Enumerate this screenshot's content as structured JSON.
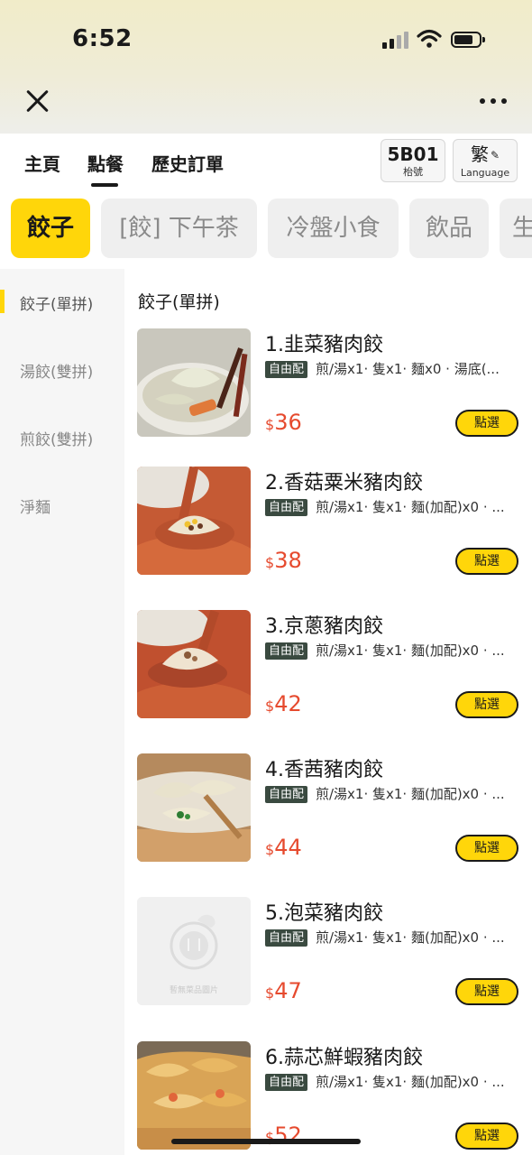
{
  "status_bar": {
    "time": "6:52"
  },
  "nav": {
    "tabs": [
      {
        "label": "主頁",
        "active": false
      },
      {
        "label": "點餐",
        "active": true
      },
      {
        "label": "歷史訂單",
        "active": false
      }
    ],
    "table_number": "5B01",
    "table_label": "枱號",
    "language_value": "繁",
    "language_label": "Language"
  },
  "categories": [
    {
      "label": "餃子",
      "active": true
    },
    {
      "label": "[餃] 下午茶",
      "active": false
    },
    {
      "label": "冷盤小食",
      "active": false
    },
    {
      "label": "飲品",
      "active": false
    },
    {
      "label": "生",
      "active": false
    }
  ],
  "sidebar": [
    {
      "label": "餃子(單拼)",
      "active": true
    },
    {
      "label": "湯餃(雙拼)",
      "active": false
    },
    {
      "label": "煎餃(雙拼)",
      "active": false
    },
    {
      "label": "淨麵",
      "active": false
    }
  ],
  "section_title": "餃子(單拼)",
  "items": [
    {
      "name": "1.韭菜豬肉餃",
      "tag": "自由配",
      "desc": "煎/湯x1· 隻x1· 麵x0 · 湯底(...",
      "currency": "$",
      "price": "36",
      "button": "點選",
      "image": "photo"
    },
    {
      "name": "2.香菇粟米豬肉餃",
      "tag": "自由配",
      "desc": "煎/湯x1· 隻x1· 麵(加配)x0 · ...",
      "currency": "$",
      "price": "38",
      "button": "點選",
      "image": "photo"
    },
    {
      "name": "3.京蔥豬肉餃",
      "tag": "自由配",
      "desc": "煎/湯x1· 隻x1· 麵(加配)x0 · ...",
      "currency": "$",
      "price": "42",
      "button": "點選",
      "image": "photo"
    },
    {
      "name": "4.香茜豬肉餃",
      "tag": "自由配",
      "desc": "煎/湯x1· 隻x1· 麵(加配)x0 · ...",
      "currency": "$",
      "price": "44",
      "button": "點選",
      "image": "photo"
    },
    {
      "name": "5.泡菜豬肉餃",
      "tag": "自由配",
      "desc": "煎/湯x1· 隻x1· 麵(加配)x0 · ...",
      "currency": "$",
      "price": "47",
      "button": "點選",
      "image": "placeholder",
      "placeholder_text": "暫無菜品圖片"
    },
    {
      "name": "6.蒜芯鮮蝦豬肉餃",
      "tag": "自由配",
      "desc": "煎/湯x1· 隻x1· 麵(加配)x0 · ...",
      "currency": "$",
      "price": "52",
      "button": "點選",
      "image": "photo"
    }
  ]
}
